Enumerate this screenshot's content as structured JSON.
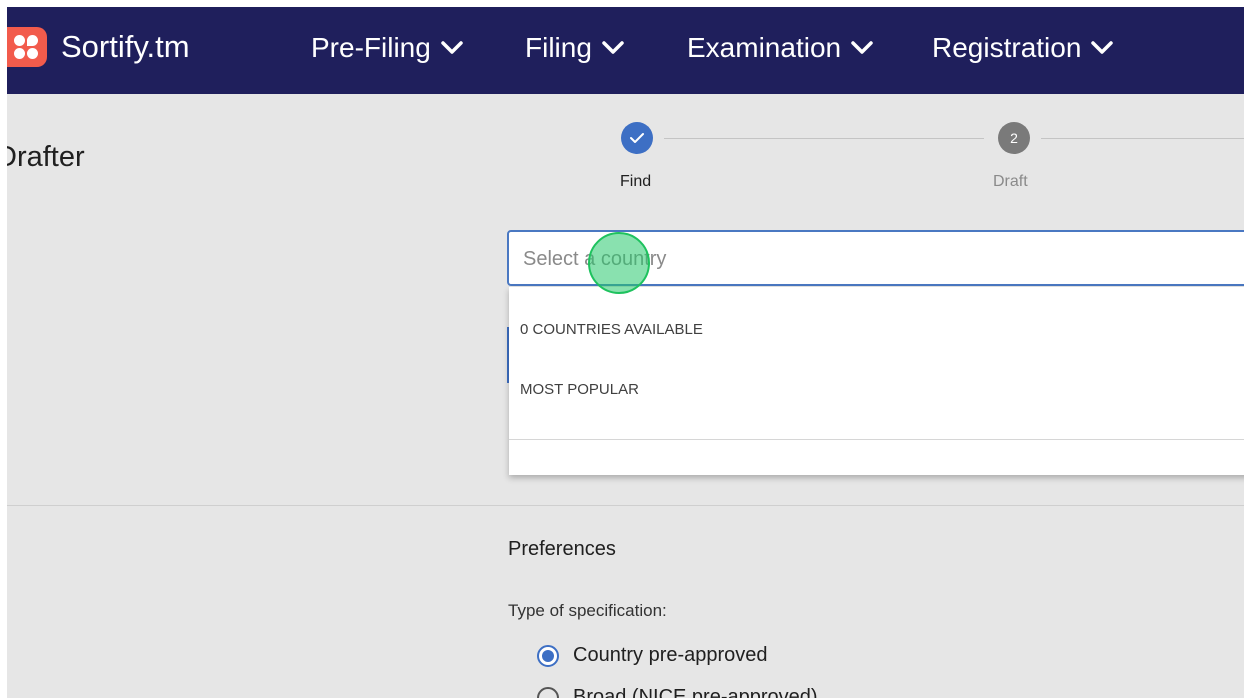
{
  "nav": {
    "brand": "Sortify.tm",
    "items": [
      {
        "label": "Pre-Filing"
      },
      {
        "label": "Filing"
      },
      {
        "label": "Examination"
      },
      {
        "label": "Registration"
      }
    ]
  },
  "page": {
    "title": "Drafter"
  },
  "stepper": {
    "steps": [
      {
        "label": "Find",
        "status": "completed",
        "number": "1"
      },
      {
        "label": "Draft",
        "status": "pending",
        "number": "2"
      }
    ]
  },
  "country_select": {
    "placeholder": "Select a country",
    "value": ""
  },
  "dropdown": {
    "available_header": "0 COUNTRIES AVAILABLE",
    "popular_header": "MOST POPULAR"
  },
  "preferences": {
    "title": "Preferences",
    "spec_label": "Type of specification:",
    "options": [
      {
        "label": "Country pre-approved",
        "checked": true
      },
      {
        "label": "Broad (NICE pre-approved)",
        "checked": false
      }
    ]
  },
  "colors": {
    "navbar": "#1f1f5c",
    "accent": "#3d6fc4",
    "brand": "#f25b4c",
    "background": "#e6e6e6"
  }
}
